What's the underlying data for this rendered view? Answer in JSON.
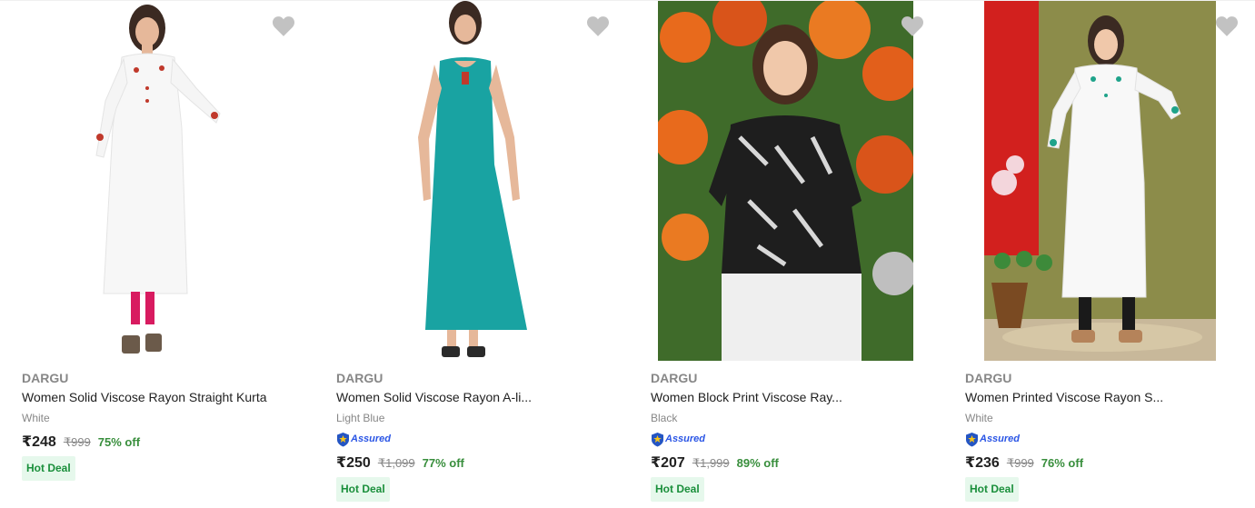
{
  "products": [
    {
      "brand": "DARGU",
      "title": "Women Solid Viscose Rayon Straight Kurta",
      "color": "White",
      "assured": false,
      "price": "₹248",
      "mrp": "₹999",
      "discount": "75% off",
      "badge": "Hot Deal",
      "image": "white kurta with floral embroidery, pink leggings"
    },
    {
      "brand": "DARGU",
      "title": "Women Solid Viscose Rayon A-li...",
      "color": "Light Blue",
      "assured": true,
      "assured_label": "Assured",
      "price": "₹250",
      "mrp": "₹1,099",
      "discount": "77% off",
      "badge": "Hot Deal",
      "image": "teal sleeveless long A-line kurta"
    },
    {
      "brand": "DARGU",
      "title": "Women Block Print Viscose Ray...",
      "color": "Black",
      "assured": true,
      "assured_label": "Assured",
      "price": "₹207",
      "mrp": "₹1,999",
      "discount": "89% off",
      "badge": "Hot Deal",
      "image": "black block print short kurti, orange flower background"
    },
    {
      "brand": "DARGU",
      "title": "Women Printed Viscose Rayon S...",
      "color": "White",
      "assured": true,
      "assured_label": "Assured",
      "price": "₹236",
      "mrp": "₹999",
      "discount": "76% off",
      "badge": "Hot Deal",
      "image": "white printed kurta, red curtain and olive wall background"
    }
  ],
  "icons": {
    "wishlist": "heart-icon",
    "assured": "shield-icon"
  },
  "colors": {
    "discount": "#388e3c",
    "badge_bg": "#e6f8ec",
    "badge_text": "#1a8f3b",
    "assured": "#2a55e5",
    "heart": "#c2c2c2"
  }
}
